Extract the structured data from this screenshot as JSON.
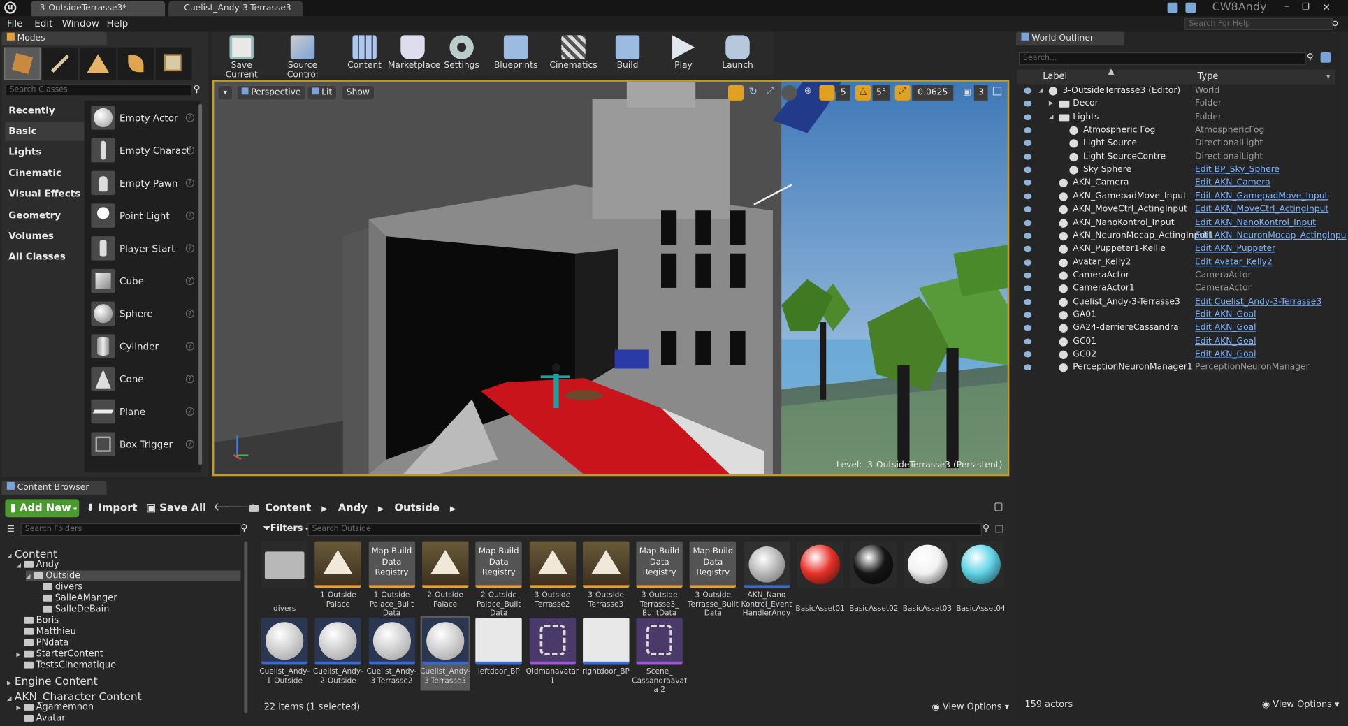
{
  "window": {
    "tabs": [
      "3-OutsideTerrasse3*",
      "Cuelist_Andy-3-Terrasse3"
    ],
    "user": "CW8Andy",
    "search_help_placeholder": "Search For Help"
  },
  "menu": [
    "File",
    "Edit",
    "Window",
    "Help"
  ],
  "modes": {
    "title": "Modes",
    "search_placeholder": "Search Classes",
    "categories": [
      "Recently Placed",
      "Basic",
      "Lights",
      "Cinematic",
      "Visual Effects",
      "Geometry",
      "Volumes",
      "All Classes"
    ],
    "selected_category": "Basic",
    "items": [
      "Empty Actor",
      "Empty Charact",
      "Empty Pawn",
      "Point Light",
      "Player Start",
      "Cube",
      "Sphere",
      "Cylinder",
      "Cone",
      "Plane",
      "Box Trigger"
    ]
  },
  "toolbar": {
    "buttons": [
      "Save Current",
      "Source Control",
      "Content",
      "Marketplace",
      "Settings",
      "Blueprints",
      "Cinematics",
      "Build",
      "Play",
      "Launch"
    ]
  },
  "viewport": {
    "view_mode": "Perspective",
    "lit": "Lit",
    "show": "Show",
    "grid_snap": "5",
    "rot_snap": "5°",
    "scale_snap": "0.0625",
    "camera_speed": "3",
    "level_label": "Level:",
    "level_name": "3-OutsideTerrasse3 (Persistent)"
  },
  "outliner": {
    "title": "World Outliner",
    "search_placeholder": "Search...",
    "col_label": "Label",
    "col_type": "Type",
    "rows": [
      {
        "label": "3-OutsideTerrasse3 (Editor)",
        "type": "World",
        "link": false,
        "indent": 0
      },
      {
        "label": "Decor",
        "type": "Folder",
        "link": false,
        "indent": 1
      },
      {
        "label": "Lights",
        "type": "Folder",
        "link": false,
        "indent": 1
      },
      {
        "label": "Atmospheric Fog",
        "type": "AtmosphericFog",
        "link": false,
        "indent": 2
      },
      {
        "label": "Light Source",
        "type": "DirectionalLight",
        "link": false,
        "indent": 2
      },
      {
        "label": "Light SourceContre",
        "type": "DirectionalLight",
        "link": false,
        "indent": 2
      },
      {
        "label": "Sky Sphere",
        "type": "Edit BP_Sky_Sphere",
        "link": true,
        "indent": 2
      },
      {
        "label": "AKN_Camera",
        "type": "Edit AKN_Camera",
        "link": true,
        "indent": 1
      },
      {
        "label": "AKN_GamepadMove_Input",
        "type": "Edit AKN_GamepadMove_Input",
        "link": true,
        "indent": 1
      },
      {
        "label": "AKN_MoveCtrl_ActingInput",
        "type": "Edit AKN_MoveCtrl_ActingInput",
        "link": true,
        "indent": 1
      },
      {
        "label": "AKN_NanoKontrol_Input",
        "type": "Edit AKN_NanoKontrol_Input",
        "link": true,
        "indent": 1
      },
      {
        "label": "AKN_NeuronMocap_ActingInput1",
        "type": "Edit AKN_NeuronMocap_ActingInpu",
        "link": true,
        "indent": 1
      },
      {
        "label": "AKN_Puppeter1-Kellie",
        "type": "Edit AKN_Puppeter",
        "link": true,
        "indent": 1
      },
      {
        "label": "Avatar_Kelly2",
        "type": "Edit Avatar_Kelly2",
        "link": true,
        "indent": 1
      },
      {
        "label": "CameraActor",
        "type": "CameraActor",
        "link": false,
        "indent": 1
      },
      {
        "label": "CameraActor1",
        "type": "CameraActor",
        "link": false,
        "indent": 1
      },
      {
        "label": "Cuelist_Andy-3-Terrasse3",
        "type": "Edit Cuelist_Andy-3-Terrasse3",
        "link": true,
        "indent": 1
      },
      {
        "label": "GA01",
        "type": "Edit AKN_Goal",
        "link": true,
        "indent": 1
      },
      {
        "label": "GA24-derriereCassandra",
        "type": "Edit AKN_Goal",
        "link": true,
        "indent": 1
      },
      {
        "label": "GC01",
        "type": "Edit AKN_Goal",
        "link": true,
        "indent": 1
      },
      {
        "label": "GC02",
        "type": "Edit AKN_Goal",
        "link": true,
        "indent": 1
      },
      {
        "label": "PerceptionNeuronManager1",
        "type": "PerceptionNeuronManager",
        "link": false,
        "indent": 1
      }
    ],
    "actor_count": "159 actors",
    "view_options": "View Options"
  },
  "content_browser": {
    "title": "Content Browser",
    "add_new": "Add New",
    "import": "Import",
    "save_all": "Save All",
    "breadcrumb": [
      "Content",
      "Andy",
      "Outside"
    ],
    "search_folders_placeholder": "Search Folders",
    "filters": "Filters",
    "search_placeholder": "Search Outside",
    "tree": [
      {
        "label": "Content",
        "level": 0,
        "big": true
      },
      {
        "label": "Andy",
        "level": 1
      },
      {
        "label": "Outside",
        "level": 2,
        "selected": true
      },
      {
        "label": "divers",
        "level": 3
      },
      {
        "label": "SalleAManger",
        "level": 3
      },
      {
        "label": "SalleDeBain",
        "level": 3
      },
      {
        "label": "Boris",
        "level": 1
      },
      {
        "label": "Matthieu",
        "level": 1
      },
      {
        "label": "PNdata",
        "level": 1
      },
      {
        "label": "StarterContent",
        "level": 1
      },
      {
        "label": "TestsCinematique",
        "level": 1
      },
      {
        "label": "Engine Content",
        "level": 0,
        "big": true
      },
      {
        "label": "AKN_Character Content",
        "level": 0,
        "big": true
      },
      {
        "label": "Agamemnon",
        "level": 1
      },
      {
        "label": "Avatar",
        "level": 1
      }
    ],
    "assets_row1": [
      {
        "name": "divers",
        "kind": "folder",
        "thumb": ""
      },
      {
        "name": "1-Outside Palace",
        "kind": "map",
        "thumb": ""
      },
      {
        "name": "1-Outside Palace_Built Data",
        "kind": "registry",
        "thumb": "Map Build Data Registry"
      },
      {
        "name": "2-Outside Palace",
        "kind": "map",
        "thumb": ""
      },
      {
        "name": "2-Outside Palace_Built Data",
        "kind": "registry",
        "thumb": "Map Build Data Registry"
      },
      {
        "name": "3-Outside Terrasse2",
        "kind": "map",
        "thumb": ""
      },
      {
        "name": "3-Outside Terrasse3",
        "kind": "map",
        "thumb": ""
      },
      {
        "name": "3-Outside Terrasse3_ BuiltData",
        "kind": "registry",
        "thumb": "Map Build Data Registry"
      },
      {
        "name": "3-Outside Terrasse_Built Data",
        "kind": "registry",
        "thumb": "Map Build Data Registry"
      },
      {
        "name": "AKN_Nano Kontrol_Event HandlerAndy",
        "kind": "nano",
        "thumb": ""
      },
      {
        "name": "BasicAsset01",
        "kind": "ball",
        "thumb": "",
        "color": "#e8322a"
      },
      {
        "name": "BasicAsset02",
        "kind": "ball",
        "thumb": "",
        "color": "#151515"
      },
      {
        "name": "BasicAsset03",
        "kind": "ball",
        "thumb": "",
        "color": "#f2f2f2"
      },
      {
        "name": "BasicAsset04",
        "kind": "ball",
        "thumb": "",
        "color": "#5fd3e6"
      }
    ],
    "assets_row2": [
      {
        "name": "Cuelist_Andy- 1-Outside",
        "kind": "cue",
        "thumb": ""
      },
      {
        "name": "Cuelist_Andy- 2-Outside",
        "kind": "cue",
        "thumb": ""
      },
      {
        "name": "Cuelist_Andy- 3-Terrasse2",
        "kind": "cue",
        "thumb": ""
      },
      {
        "name": "Cuelist_Andy- 3-Terrasse3",
        "kind": "cue",
        "thumb": "",
        "selected": true
      },
      {
        "name": "leftdoor_BP",
        "kind": "bp",
        "thumb": ""
      },
      {
        "name": "Oldmanavatar 1",
        "kind": "anim",
        "thumb": ""
      },
      {
        "name": "rightdoor_BP",
        "kind": "bp",
        "thumb": ""
      },
      {
        "name": "Scene_ Cassandraavata 2",
        "kind": "anim",
        "thumb": ""
      }
    ],
    "items_status": "22 items (1 selected)",
    "view_options": "View Options"
  },
  "colors": {
    "accent": "#4a9de6",
    "add_new_green": "#4a9b2e",
    "red_carpet": "#c8141a",
    "selection": "#5a5a5a"
  }
}
